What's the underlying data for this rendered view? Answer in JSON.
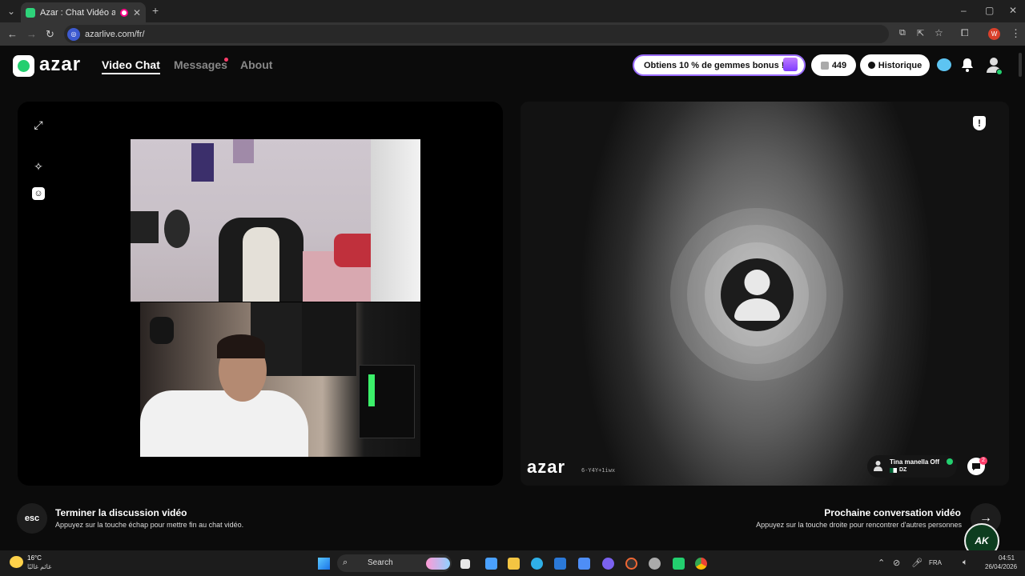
{
  "browser": {
    "tab_title": "Azar : Chat Vidéo avec de n",
    "url": "azarlive.com/fr/",
    "profile_letter": "W"
  },
  "header": {
    "logo_text": "azar",
    "nav": {
      "video_chat": "Video Chat",
      "messages": "Messages",
      "about": "About"
    },
    "promo": "Obtiens 10 % de gemmes bonus !",
    "gems": "449",
    "history": "Historique"
  },
  "remote": {
    "watermark": "azar",
    "code": "6-Y4Y+1iwx",
    "peer_name": "Tina manella Off",
    "peer_country": "DZ",
    "chat_badge": "2"
  },
  "footer": {
    "esc_label": "esc",
    "end_title": "Terminer la discussion vidéo",
    "end_sub": "Appuyez sur la touche échap pour mettre fin au chat vidéo.",
    "next_title": "Prochaine conversation vidéo",
    "next_sub": "Appuyez sur la touche droite pour rencontrer d'autres personnes",
    "next_arrow": "→",
    "overlay_logo": "AK"
  },
  "taskbar": {
    "temp": "16°C",
    "weather_desc": "غائم غالبًا",
    "search": "Search",
    "lang": "FRA",
    "time": "04:51",
    "date": "26/04/2026"
  },
  "colors": {
    "accent_green": "#23cf6f",
    "promo_border": "#9a6cff",
    "badge": "#ff3c6a"
  }
}
